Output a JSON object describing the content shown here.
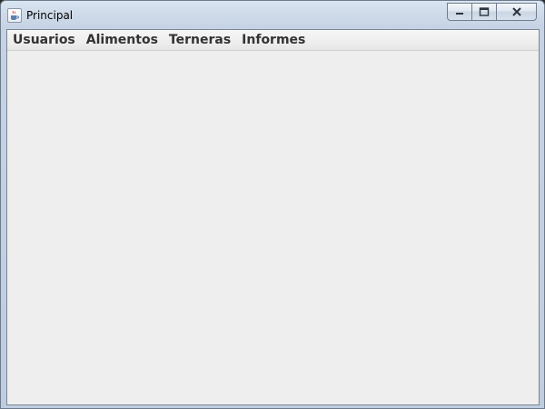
{
  "window": {
    "title": "Principal",
    "icon": "java-cup-icon"
  },
  "caption_buttons": {
    "minimize_icon": "minimize-icon",
    "maximize_icon": "maximize-icon",
    "close_icon": "close-icon"
  },
  "menubar": {
    "items": [
      {
        "label": "Usuarios"
      },
      {
        "label": "Alimentos"
      },
      {
        "label": "Terneras"
      },
      {
        "label": "Informes"
      }
    ]
  }
}
